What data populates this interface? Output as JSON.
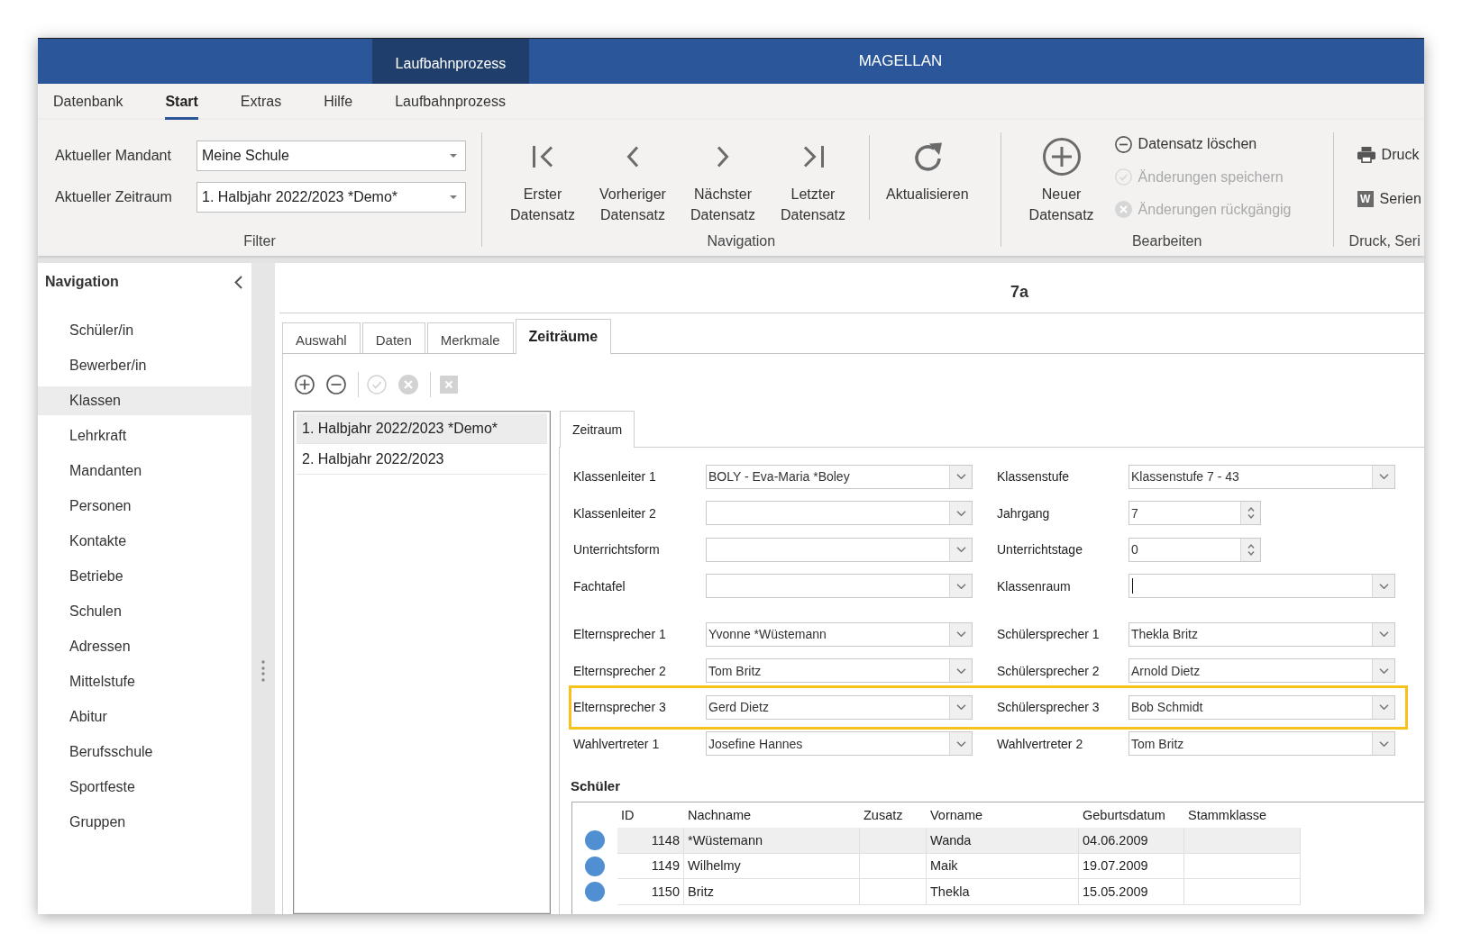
{
  "title_bar": {
    "context_tab": "Laufbahnprozess",
    "title": "MAGELLAN"
  },
  "menu": [
    {
      "label": "Datenbank",
      "selected": false
    },
    {
      "label": "Start",
      "selected": true
    },
    {
      "label": "Extras",
      "selected": false
    },
    {
      "label": "Hilfe",
      "selected": false
    },
    {
      "label": "Laufbahnprozess",
      "selected": false
    }
  ],
  "ribbon": {
    "groups": [
      {
        "label": "Filter",
        "items": [
          {
            "kind": "combo",
            "label": "Aktueller Mandant",
            "value": "Meine Schule"
          },
          {
            "kind": "combo",
            "label": "Aktueller Zeitraum",
            "value": "1. Halbjahr 2022/2023 *Demo*"
          }
        ]
      },
      {
        "label": "Navigation",
        "items": [
          {
            "kind": "first",
            "label": "Erster\nDatensatz"
          },
          {
            "kind": "previous",
            "label": "Vorheriger\nDatensatz"
          },
          {
            "kind": "next",
            "label": "Nächster\nDatensatz"
          },
          {
            "kind": "last",
            "label": "Letzter\nDatensatz"
          },
          {
            "kind": "separator"
          },
          {
            "kind": "refresh",
            "label": "Aktualisieren"
          }
        ]
      },
      {
        "label": "Bearbeiten",
        "items": [
          {
            "kind": "add",
            "label": "Neuer\nDatensatz",
            "disabled": false
          },
          {
            "kind": "delete",
            "label": "Datensatz löschen",
            "disabled": false
          },
          {
            "kind": "save",
            "label": "Änderungen speichern",
            "disabled": true
          },
          {
            "kind": "undo",
            "label": "Änderungen rückgängig",
            "disabled": true
          }
        ]
      },
      {
        "label": "Druck, Seri",
        "items": [
          {
            "kind": "print",
            "label": "Druck"
          },
          {
            "kind": "mail_merge",
            "label": "Serien",
            "icon_text": "W"
          }
        ]
      }
    ]
  },
  "sidebar": {
    "title": "Navigation",
    "items": [
      {
        "label": "Schüler/in",
        "selected": false
      },
      {
        "label": "Bewerber/in",
        "selected": false
      },
      {
        "label": "Klassen",
        "selected": true
      },
      {
        "label": "Lehrkraft",
        "selected": false
      },
      {
        "label": "Mandanten",
        "selected": false
      },
      {
        "label": "Personen",
        "selected": false
      },
      {
        "label": "Kontakte",
        "selected": false
      },
      {
        "label": "Betriebe",
        "selected": false
      },
      {
        "label": "Schulen",
        "selected": false
      },
      {
        "label": "Adressen",
        "selected": false
      },
      {
        "label": "Mittelstufe",
        "selected": false
      },
      {
        "label": "Abitur",
        "selected": false
      },
      {
        "label": "Berufsschule",
        "selected": false
      },
      {
        "label": "Sportfeste",
        "selected": false
      },
      {
        "label": "Gruppen",
        "selected": false
      }
    ]
  },
  "main": {
    "heading": "7a",
    "tabs": [
      {
        "label": "Auswahl",
        "selected": false
      },
      {
        "label": "Daten",
        "selected": false
      },
      {
        "label": "Merkmale",
        "selected": false
      },
      {
        "label": "Zeiträume",
        "selected": true
      }
    ],
    "toolbar": [
      {
        "kind": "add",
        "disabled": false
      },
      {
        "kind": "remove",
        "disabled": false
      },
      {
        "kind": "separator"
      },
      {
        "kind": "confirm",
        "disabled": true
      },
      {
        "kind": "cancel",
        "disabled": true
      },
      {
        "kind": "separator"
      },
      {
        "kind": "export",
        "disabled": true
      }
    ],
    "periods": [
      {
        "label": "1. Halbjahr 2022/2023 *Demo*",
        "selected": true
      },
      {
        "label": "2. Halbjahr 2022/2023",
        "selected": false
      }
    ],
    "detail": {
      "tabs": [
        {
          "label": "Zeitraum",
          "selected": true
        }
      ],
      "groups": [
        {
          "rows": [
            {
              "highlighted": false,
              "left": {
                "label": "Klassenleiter 1",
                "kind": "combo",
                "value": "BOLY - Eva-Maria *Boley",
                "focused": false
              },
              "right": {
                "label": "Klassenstufe",
                "kind": "combo",
                "value": "Klassenstufe 7 - 43",
                "focused": false
              }
            },
            {
              "highlighted": false,
              "left": {
                "label": "Klassenleiter 2",
                "kind": "combo",
                "focused": false
              },
              "right": {
                "label": "Jahrgang",
                "kind": "spin",
                "value": "7",
                "focused": false
              }
            },
            {
              "highlighted": false,
              "left": {
                "label": "Unterrichtsform",
                "kind": "combo",
                "focused": false
              },
              "right": {
                "label": "Unterrichtstage",
                "kind": "spin",
                "value": "0",
                "focused": false
              }
            },
            {
              "highlighted": false,
              "left": {
                "label": "Fachtafel",
                "kind": "combo",
                "focused": false
              },
              "right": {
                "label": "Klassenraum",
                "kind": "combo",
                "focused": true
              }
            }
          ]
        },
        {
          "rows": [
            {
              "highlighted": false,
              "left": {
                "label": "Elternsprecher 1",
                "kind": "combo",
                "value": "Yvonne *Wüstemann",
                "focused": false
              },
              "right": {
                "label": "Schülersprecher 1",
                "kind": "combo",
                "value": "Thekla Britz",
                "focused": false
              }
            },
            {
              "highlighted": false,
              "left": {
                "label": "Elternsprecher 2",
                "kind": "combo",
                "value": "Tom Britz",
                "focused": false
              },
              "right": {
                "label": "Schülersprecher 2",
                "kind": "combo",
                "value": "Arnold Dietz",
                "focused": false
              }
            },
            {
              "highlighted": true,
              "left": {
                "label": "Elternsprecher 3",
                "kind": "combo",
                "value": "Gerd Dietz",
                "focused": false
              },
              "right": {
                "label": "Schülersprecher 3",
                "kind": "combo",
                "value": "Bob Schmidt",
                "focused": false
              }
            },
            {
              "highlighted": false,
              "left": {
                "label": "Wahlvertreter 1",
                "kind": "combo",
                "value": "Josefine Hannes",
                "focused": false
              },
              "right": {
                "label": "Wahlvertreter 2",
                "kind": "combo",
                "value": "Tom Britz",
                "focused": false
              }
            }
          ]
        }
      ],
      "students": {
        "title": "Schüler",
        "columns": [
          {
            "label": "ID",
            "kind": "number"
          },
          {
            "label": "Nachname",
            "kind": "text"
          },
          {
            "label": "Zusatz",
            "kind": "text"
          },
          {
            "label": "Vorname",
            "kind": "text"
          },
          {
            "label": "Geburtsdatum",
            "kind": "text"
          },
          {
            "label": "Stammklasse",
            "kind": "text"
          }
        ],
        "rows": [
          {
            "selected": true,
            "cells": [
              "1148",
              "*Wüstemann",
              null,
              "Wanda",
              "04.06.2009",
              null
            ]
          },
          {
            "selected": false,
            "cells": [
              "1149",
              "Wilhelmy",
              null,
              "Maik",
              "19.07.2009",
              null
            ]
          },
          {
            "selected": false,
            "cells": [
              "1150",
              "Britz",
              null,
              "Thekla",
              "15.05.2009",
              null
            ]
          }
        ]
      }
    }
  }
}
